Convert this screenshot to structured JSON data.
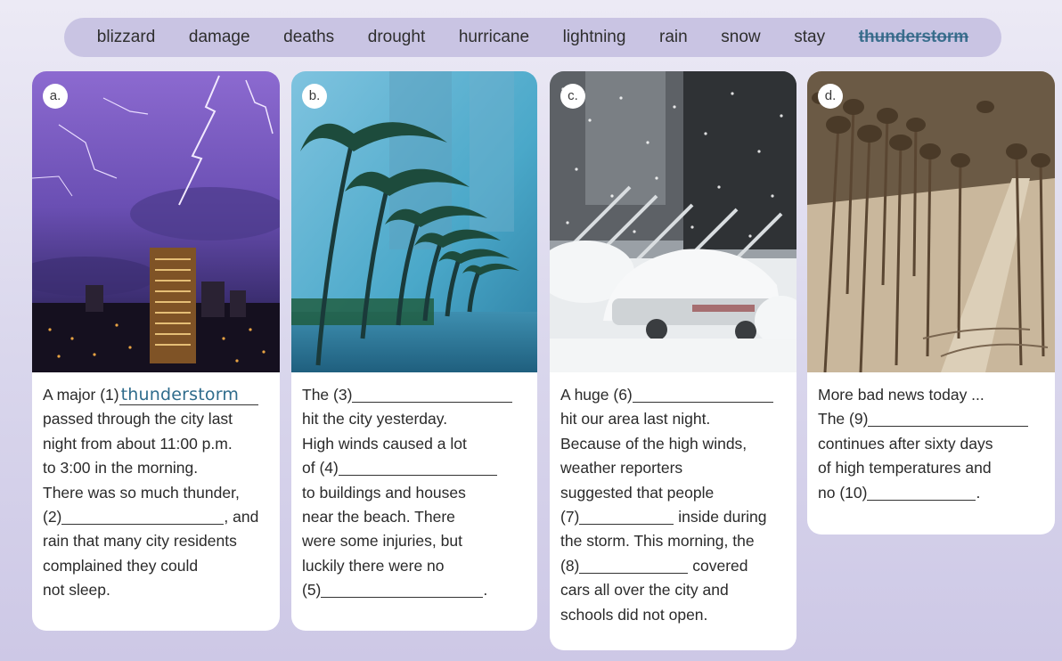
{
  "word_bank": [
    "blizzard",
    "damage",
    "deaths",
    "drought",
    "hurricane",
    "lightning",
    "rain",
    "snow",
    "stay",
    "thunderstorm"
  ],
  "cards": [
    {
      "letter": "a.",
      "photo_icon": "lightning-city-photo",
      "lines": [
        "A major (1)",
        "passed through the city last",
        "night from about 11:00 p.m.",
        "to 3:00 in the morning.",
        "There was so much thunder,",
        "(2)",
        ", and",
        "rain that many city residents",
        "complained they could",
        "not sleep."
      ],
      "answer_1": "thunderstorm"
    },
    {
      "letter": "b.",
      "photo_icon": "hurricane-palms-photo",
      "lines": [
        "The (3)",
        "hit the city yesterday.",
        "High winds caused a lot",
        "of (4)",
        "to buildings and houses",
        "near the beach. There",
        "were some injuries, but",
        "luckily there were no",
        "(5)",
        "."
      ]
    },
    {
      "letter": "c.",
      "photo_icon": "blizzard-cars-photo",
      "lines": [
        "A huge (6)",
        "hit our area last night.",
        "Because of the high winds,",
        "weather reporters",
        "suggested that people",
        "(7)",
        "inside during",
        "the storm. This morning, the",
        "(8)",
        "covered",
        "cars all over the city and",
        "schools did not open."
      ]
    },
    {
      "letter": "d.",
      "photo_icon": "drought-field-photo",
      "lines": [
        "More bad news today ...",
        "The (9)",
        "continues after sixty days",
        "of high temperatures and",
        "no (10)",
        "."
      ]
    }
  ]
}
